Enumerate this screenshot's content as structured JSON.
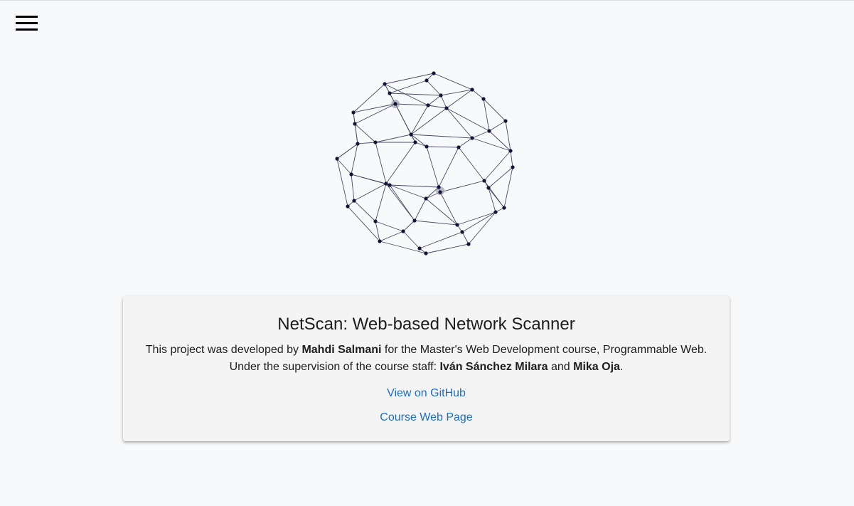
{
  "header": {
    "menu_icon": "hamburger-menu-icon"
  },
  "hero": {
    "graphic_icon": "network-globe-icon",
    "colors": {
      "stroke": "#2b2b4a",
      "node": "#14143a",
      "highlight": "#8a8a9a"
    }
  },
  "info_card": {
    "title": "NetScan: Web-based Network Scanner",
    "line1": {
      "prefix": "This project was developed by ",
      "author": "Mahdi Salmani",
      "suffix": " for the Master's Web Development course, Programmable Web."
    },
    "line2": {
      "prefix": "Under the supervision of the course staff: ",
      "staff1": "Iván Sánchez Milara",
      "conjunction": " and ",
      "staff2": "Mika Oja",
      "suffix": "."
    },
    "github_link": "View on GitHub",
    "course_link": "Course Web Page",
    "link_color": "#1a6fc2"
  }
}
